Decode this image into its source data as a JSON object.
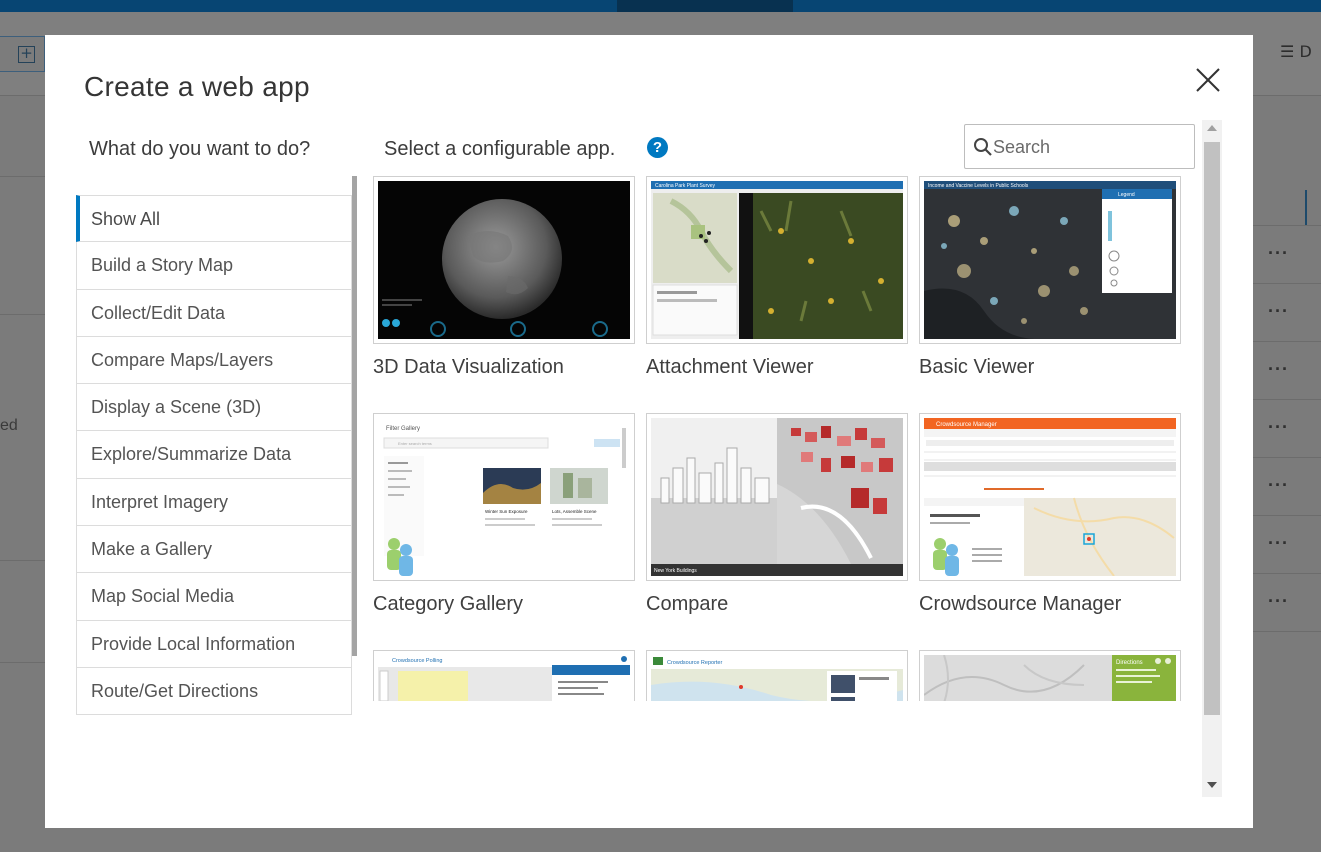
{
  "modal": {
    "title": "Create a web app",
    "left_heading": "What do you want to do?",
    "right_heading": "Select a configurable app.",
    "search_placeholder": "Search"
  },
  "categories": [
    {
      "label": "Show All",
      "active": true
    },
    {
      "label": "Build a Story Map",
      "active": false
    },
    {
      "label": "Collect/Edit Data",
      "active": false
    },
    {
      "label": "Compare Maps/Layers",
      "active": false
    },
    {
      "label": "Display a Scene (3D)",
      "active": false
    },
    {
      "label": "Explore/Summarize Data",
      "active": false
    },
    {
      "label": "Interpret Imagery",
      "active": false
    },
    {
      "label": "Make a Gallery",
      "active": false
    },
    {
      "label": "Map Social Media",
      "active": false
    },
    {
      "label": "Provide Local Information",
      "active": false
    },
    {
      "label": "Route/Get Directions",
      "active": false
    }
  ],
  "apps": [
    {
      "label": "3D Data Visualization",
      "thumb": "globe-night"
    },
    {
      "label": "Attachment Viewer",
      "thumb": "map-photo"
    },
    {
      "label": "Basic Viewer",
      "thumb": "dark-points-map"
    },
    {
      "label": "Category Gallery",
      "thumb": "filter-gallery"
    },
    {
      "label": "Compare",
      "thumb": "city-3d"
    },
    {
      "label": "Crowdsource Manager",
      "thumb": "orange-table"
    },
    {
      "label": "",
      "thumb": "crowdsource-polling"
    },
    {
      "label": "",
      "thumb": "crowdsource-reporter"
    },
    {
      "label": "",
      "thumb": "directions-map"
    }
  ],
  "thumb_text": {
    "attachment_title": "Carolina Park Plant Survey",
    "basic_title": "Income and Vaccine Levels in Public Schools",
    "basic_legend": "Legend",
    "gallery_title": "Filter Gallery",
    "gallery_search": "Enter search terms",
    "gallery_card1": "Winter Sun Exposure",
    "gallery_card2": "Lots, Assemble Scene",
    "compare_caption": "New York Buildings",
    "crowd_title": "Crowdsource Manager",
    "polling_title": "Crowdsource Polling",
    "reporter_title": "Crowdsource Reporter",
    "directions_title": "Directions"
  },
  "background": {
    "left_text": "ed",
    "sort_label": "D"
  },
  "colors": {
    "accent": "#0079c1",
    "overlay_bg": "#7b7b7b",
    "top_bar": "#074573",
    "orange_header": "#f26522",
    "green_header": "#8ab43c"
  },
  "icons": {
    "close": "close-icon",
    "help": "help-icon",
    "search": "search-icon"
  },
  "help_glyph": "?"
}
